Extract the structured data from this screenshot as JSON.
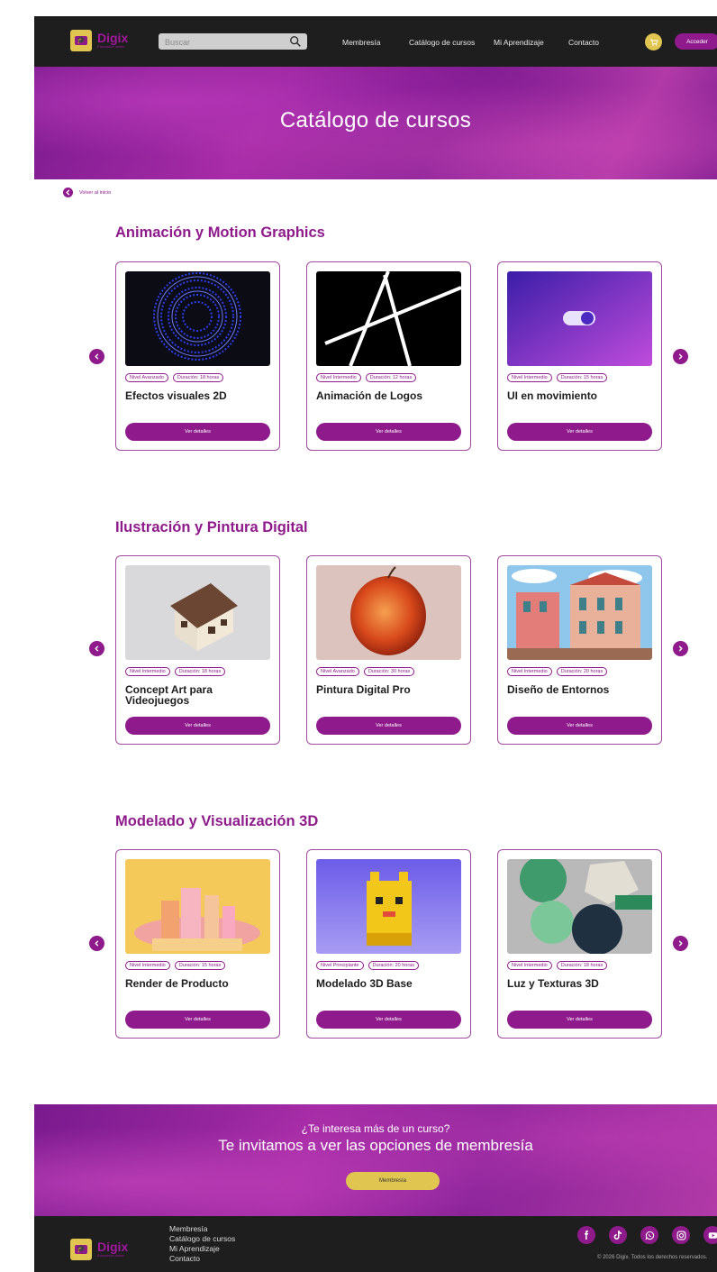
{
  "header": {
    "logo_name": "Digix",
    "logo_sub": "Educación online",
    "search_placeholder": "Buscar",
    "nav": [
      "Membresía",
      "Catálogo de cursos",
      "Mi Aprendizaje",
      "Contacto"
    ],
    "login_label": "Acceder"
  },
  "hero": {
    "title": "Catálogo de cursos"
  },
  "back_label": "Volver al inicio",
  "sections": [
    {
      "title": "Animación y Motion Graphics",
      "cards": [
        {
          "level": "Nivel Avanzado",
          "duration": "Duración: 18 horas",
          "title": "Efectos visuales 2D",
          "button": "Ver detalles"
        },
        {
          "level": "Nivel Intermedio",
          "duration": "Duración: 12 horas",
          "title": "Animación de Logos",
          "button": "Ver detalles"
        },
        {
          "level": "Nivel Intermedio",
          "duration": "Duración: 15 horas",
          "title": "UI en movimiento",
          "button": "Ver detalles"
        }
      ]
    },
    {
      "title": "Ilustración y Pintura Digital",
      "cards": [
        {
          "level": "Nivel Intermedio",
          "duration": "Duración: 18 horas",
          "title": "Concept Art para Videojuegos",
          "button": "Ver detalles"
        },
        {
          "level": "Nivel Avanzado",
          "duration": "Duración: 30 horas",
          "title": "Pintura Digital Pro",
          "button": "Ver detalles"
        },
        {
          "level": "Nivel Intermedio",
          "duration": "Duración: 20 horas",
          "title": "Diseño de Entornos",
          "button": "Ver detalles"
        }
      ]
    },
    {
      "title": "Modelado y Visualización 3D",
      "cards": [
        {
          "level": "Nivel Intermedio",
          "duration": "Duración: 15 horas",
          "title": "Render de Producto",
          "button": "Ver detalles"
        },
        {
          "level": "Nivel Principiante",
          "duration": "Duración: 20 horas",
          "title": "Modelado 3D Base",
          "button": "Ver detalles"
        },
        {
          "level": "Nivel Intermedio",
          "duration": "Duración: 18 horas",
          "title": "Luz y Texturas 3D",
          "button": "Ver detalles"
        }
      ]
    }
  ],
  "cta": {
    "question": "¿Te interesa más de un curso?",
    "headline": "Te invitamos a ver las opciones de membresía",
    "button": "Membresía"
  },
  "footer": {
    "links": [
      "Membresía",
      "Catálogo de cursos",
      "Mi Aprendizaje",
      "Contacto"
    ],
    "social_icons": [
      "facebook-icon",
      "tiktok-icon",
      "whatsapp-icon",
      "instagram-icon",
      "youtube-icon"
    ],
    "copyright": "© 2026 Digix. Todos los derechos reservados."
  },
  "colors": {
    "brand_purple": "#8e1a8b",
    "accent_yellow": "#e0c650",
    "dark": "#1e1e1e"
  }
}
